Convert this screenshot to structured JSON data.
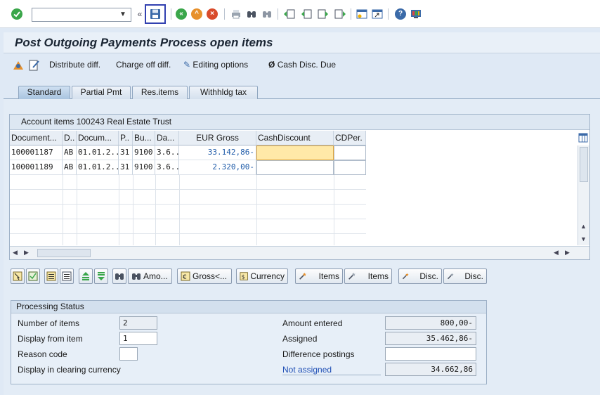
{
  "toolbar": {
    "command_placeholder": "",
    "icons": [
      "enter-icon",
      "save-icon",
      "back-icon",
      "exit-icon",
      "cancel-icon",
      "print-icon",
      "find-icon",
      "find-next-icon",
      "first-page-icon",
      "prev-page-icon",
      "next-page-icon",
      "last-page-icon",
      "new-session-icon",
      "shortcut-icon",
      "help-icon",
      "customize-icon"
    ]
  },
  "title": "Post Outgoing Payments Process open items",
  "app_toolbar": {
    "distribute": "Distribute diff.",
    "charge_off": "Charge off diff.",
    "editing_options": "Editing options",
    "cash_disc_due": "Cash Disc. Due"
  },
  "tabs": [
    "Standard",
    "Partial Pmt",
    "Res.items",
    "Withhldg tax"
  ],
  "table": {
    "title": "Account items 100243 Real Estate Trust",
    "headers": [
      "Document...",
      "D..",
      "Docum...",
      "P..",
      "Bu...",
      "Da...",
      "EUR Gross",
      "CashDiscount",
      "CDPer."
    ],
    "rows": [
      [
        "100001187",
        "AB",
        "01.01.2...",
        "31",
        "9100",
        "3.6...",
        "33.142,86-",
        "",
        ""
      ],
      [
        "100001189",
        "AB",
        "01.01.2...",
        "31",
        "9100",
        "3.6...",
        "2.320,00-",
        "",
        ""
      ]
    ]
  },
  "buttons": {
    "amount": "Amo...",
    "gross": "Gross<...",
    "currency": "Currency",
    "items1": "Items",
    "items2": "Items",
    "disc1": "Disc.",
    "disc2": "Disc."
  },
  "status": {
    "title": "Processing Status",
    "number_of_items_label": "Number of items",
    "number_of_items": "2",
    "display_from_label": "Display from item",
    "display_from": "1",
    "reason_code_label": "Reason code",
    "reason_code": "",
    "display_clearing_label": "Display in clearing currency",
    "amount_entered_label": "Amount entered",
    "amount_entered": "800,00-",
    "assigned_label": "Assigned",
    "assigned": "35.462,86-",
    "difference_label": "Difference postings",
    "difference": "",
    "not_assigned_label": "Not assigned",
    "not_assigned": "34.662,86"
  },
  "colors": {
    "accent": "#1d5aa8",
    "focus": "#ffe9a8",
    "not_assigned": "#1f4fb5"
  }
}
